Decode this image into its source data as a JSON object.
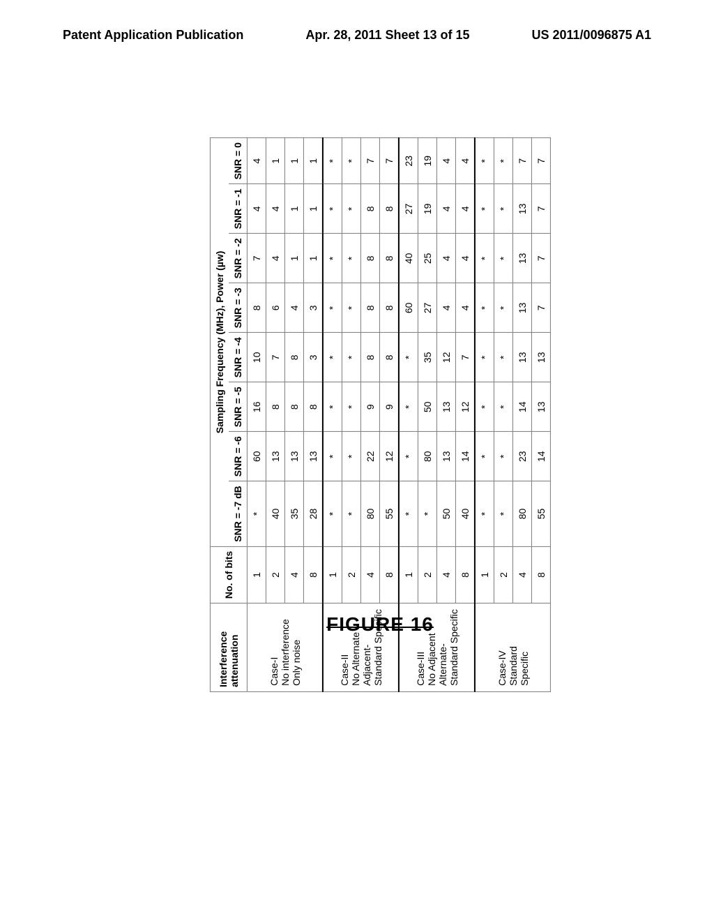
{
  "header": {
    "left": "Patent Application Publication",
    "center": "Apr. 28, 2011  Sheet 13 of 15",
    "right": "US 2011/0096875 A1"
  },
  "columns": {
    "super_left1": "Interference",
    "super_left2": "attenuation",
    "super_bits": "No. of bits",
    "super_right": "Sampling Frequency (MHz), Power (µw)",
    "c0": "SNR = -7 dB",
    "c1": "SNR = -6",
    "c2": "SNR = -5",
    "c3": "SNR = -4",
    "c4": "SNR = -3",
    "c5": "SNR = -2",
    "c6": "SNR = -1",
    "c7": "SNR = 0"
  },
  "groups": [
    {
      "label_lines": [
        "Case-I",
        "No interference",
        "Only noise"
      ],
      "rows": [
        {
          "bits": "1",
          "v": [
            "*",
            "60",
            "16",
            "10",
            "8",
            "7",
            "4",
            "4"
          ]
        },
        {
          "bits": "2",
          "v": [
            "40",
            "13",
            "8",
            "7",
            "6",
            "4",
            "4",
            "1"
          ]
        },
        {
          "bits": "4",
          "v": [
            "35",
            "13",
            "8",
            "8",
            "4",
            "1",
            "1",
            "1"
          ]
        },
        {
          "bits": "8",
          "v": [
            "28",
            "13",
            "8",
            "3",
            "3",
            "1",
            "1",
            "1"
          ]
        }
      ]
    },
    {
      "label_lines": [
        "Case-II",
        "No Alternate",
        "Adjacent-",
        "Standard Specific"
      ],
      "rows": [
        {
          "bits": "1",
          "v": [
            "*",
            "*",
            "*",
            "*",
            "*",
            "*",
            "*",
            "*"
          ]
        },
        {
          "bits": "2",
          "v": [
            "*",
            "*",
            "*",
            "*",
            "*",
            "*",
            "*",
            "*"
          ]
        },
        {
          "bits": "4",
          "v": [
            "80",
            "22",
            "9",
            "8",
            "8",
            "8",
            "8",
            "7"
          ]
        },
        {
          "bits": "8",
          "v": [
            "55",
            "12",
            "9",
            "8",
            "8",
            "8",
            "8",
            "7"
          ]
        }
      ]
    },
    {
      "label_lines": [
        "Case-III",
        "No Adjacent",
        "Alternate-",
        "Standard Specific"
      ],
      "rows": [
        {
          "bits": "1",
          "v": [
            "*",
            "*",
            "*",
            "*",
            "60",
            "40",
            "27",
            "23"
          ]
        },
        {
          "bits": "2",
          "v": [
            "*",
            "80",
            "50",
            "35",
            "27",
            "25",
            "19",
            "19"
          ]
        },
        {
          "bits": "4",
          "v": [
            "50",
            "13",
            "13",
            "12",
            "4",
            "4",
            "4",
            "4"
          ]
        },
        {
          "bits": "8",
          "v": [
            "40",
            "14",
            "12",
            "7",
            "4",
            "4",
            "4",
            "4"
          ]
        }
      ]
    },
    {
      "label_lines": [
        "Case-IV",
        "Standard",
        "Specific"
      ],
      "rows": [
        {
          "bits": "1",
          "v": [
            "*",
            "*",
            "*",
            "*",
            "*",
            "*",
            "*",
            "*"
          ]
        },
        {
          "bits": "2",
          "v": [
            "*",
            "*",
            "*",
            "*",
            "*",
            "*",
            "*",
            "*"
          ]
        },
        {
          "bits": "4",
          "v": [
            "80",
            "23",
            "14",
            "13",
            "13",
            "13",
            "13",
            "7"
          ]
        },
        {
          "bits": "8",
          "v": [
            "55",
            "14",
            "13",
            "13",
            "7",
            "7",
            "7",
            "7"
          ]
        }
      ]
    }
  ],
  "caption": "FIGURE 16",
  "chart_data": {
    "type": "table",
    "title": "Sampling Frequency (MHz), Power (µw) vs SNR and bits for interference cases",
    "columns": [
      "Interference attenuation",
      "No. of bits",
      "SNR = -7 dB",
      "SNR = -6",
      "SNR = -5",
      "SNR = -4",
      "SNR = -3",
      "SNR = -2",
      "SNR = -1",
      "SNR = 0"
    ],
    "rows": [
      [
        "Case-I No interference Only noise",
        "1",
        "*",
        "60",
        "16",
        "10",
        "8",
        "7",
        "4",
        "4"
      ],
      [
        "Case-I No interference Only noise",
        "2",
        "40",
        "13",
        "8",
        "7",
        "6",
        "4",
        "4",
        "1"
      ],
      [
        "Case-I No interference Only noise",
        "4",
        "35",
        "13",
        "8",
        "8",
        "4",
        "1",
        "1",
        "1"
      ],
      [
        "Case-I No interference Only noise",
        "8",
        "28",
        "13",
        "8",
        "3",
        "3",
        "1",
        "1",
        "1"
      ],
      [
        "Case-II No Alternate Adjacent- Standard Specific",
        "1",
        "*",
        "*",
        "*",
        "*",
        "*",
        "*",
        "*",
        "*"
      ],
      [
        "Case-II No Alternate Adjacent- Standard Specific",
        "2",
        "*",
        "*",
        "*",
        "*",
        "*",
        "*",
        "*",
        "*"
      ],
      [
        "Case-II No Alternate Adjacent- Standard Specific",
        "4",
        "80",
        "22",
        "9",
        "8",
        "8",
        "8",
        "8",
        "7"
      ],
      [
        "Case-II No Alternate Adjacent- Standard Specific",
        "8",
        "55",
        "12",
        "9",
        "8",
        "8",
        "8",
        "8",
        "7"
      ],
      [
        "Case-III No Adjacent Alternate- Standard Specific",
        "1",
        "*",
        "*",
        "*",
        "*",
        "60",
        "40",
        "27",
        "23"
      ],
      [
        "Case-III No Adjacent Alternate- Standard Specific",
        "2",
        "*",
        "80",
        "50",
        "35",
        "27",
        "25",
        "19",
        "19"
      ],
      [
        "Case-III No Adjacent Alternate- Standard Specific",
        "4",
        "50",
        "13",
        "13",
        "12",
        "4",
        "4",
        "4",
        "4"
      ],
      [
        "Case-III No Adjacent Alternate- Standard Specific",
        "8",
        "40",
        "14",
        "12",
        "7",
        "4",
        "4",
        "4",
        "4"
      ],
      [
        "Case-IV Standard Specific",
        "1",
        "*",
        "*",
        "*",
        "*",
        "*",
        "*",
        "*",
        "*"
      ],
      [
        "Case-IV Standard Specific",
        "2",
        "*",
        "*",
        "*",
        "*",
        "*",
        "*",
        "*",
        "*"
      ],
      [
        "Case-IV Standard Specific",
        "4",
        "80",
        "23",
        "14",
        "13",
        "13",
        "13",
        "13",
        "7"
      ],
      [
        "Case-IV Standard Specific",
        "8",
        "55",
        "14",
        "13",
        "13",
        "7",
        "7",
        "7",
        "7"
      ]
    ]
  }
}
